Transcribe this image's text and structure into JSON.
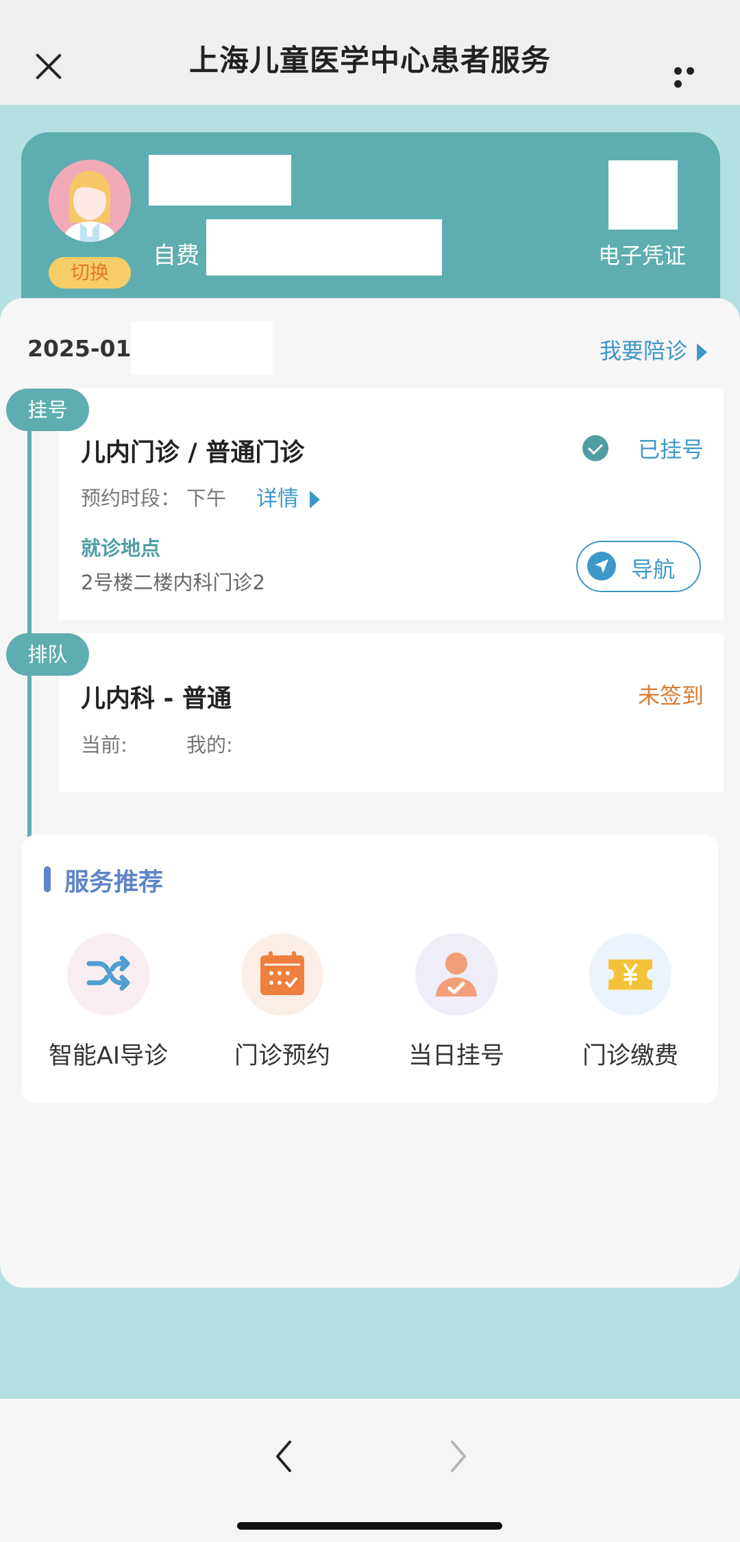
{
  "header": {
    "title": "上海儿童医学中心患者服务"
  },
  "profile": {
    "switch_label": "切换",
    "payment_type": "自费",
    "voucher_label": "电子凭证"
  },
  "date": {
    "text": "2025-01-"
  },
  "escort": {
    "label": "我要陪诊"
  },
  "registration": {
    "tag": "挂号",
    "department": "儿内门诊 / 普通门诊",
    "status": "已挂号",
    "time_label": "预约时段：",
    "time_value": "下午",
    "detail_label": "详情",
    "location_label": "就诊地点",
    "location_value": "2号楼二楼内科门诊2",
    "nav_label": "导航"
  },
  "queue": {
    "tag": "排队",
    "title": "儿内科 - 普通",
    "status": "未签到",
    "current_label": "当前:",
    "mine_label": "我的:"
  },
  "services": {
    "title": "服务推荐",
    "items": [
      {
        "label": "智能AI导诊",
        "icon": "shuffle-icon",
        "bg": "#f8eef2"
      },
      {
        "label": "门诊预约",
        "icon": "calendar-icon",
        "bg": "#fbeee6"
      },
      {
        "label": "当日挂号",
        "icon": "user-check-icon",
        "bg": "#eeedf8"
      },
      {
        "label": "门诊缴费",
        "icon": "ticket-yen-icon",
        "bg": "#ebf4fd"
      }
    ]
  },
  "colors": {
    "teal": "#5eadb1",
    "blue": "#3d97c8",
    "orange": "#d67b33",
    "page_bg": "#b4e0e1"
  }
}
